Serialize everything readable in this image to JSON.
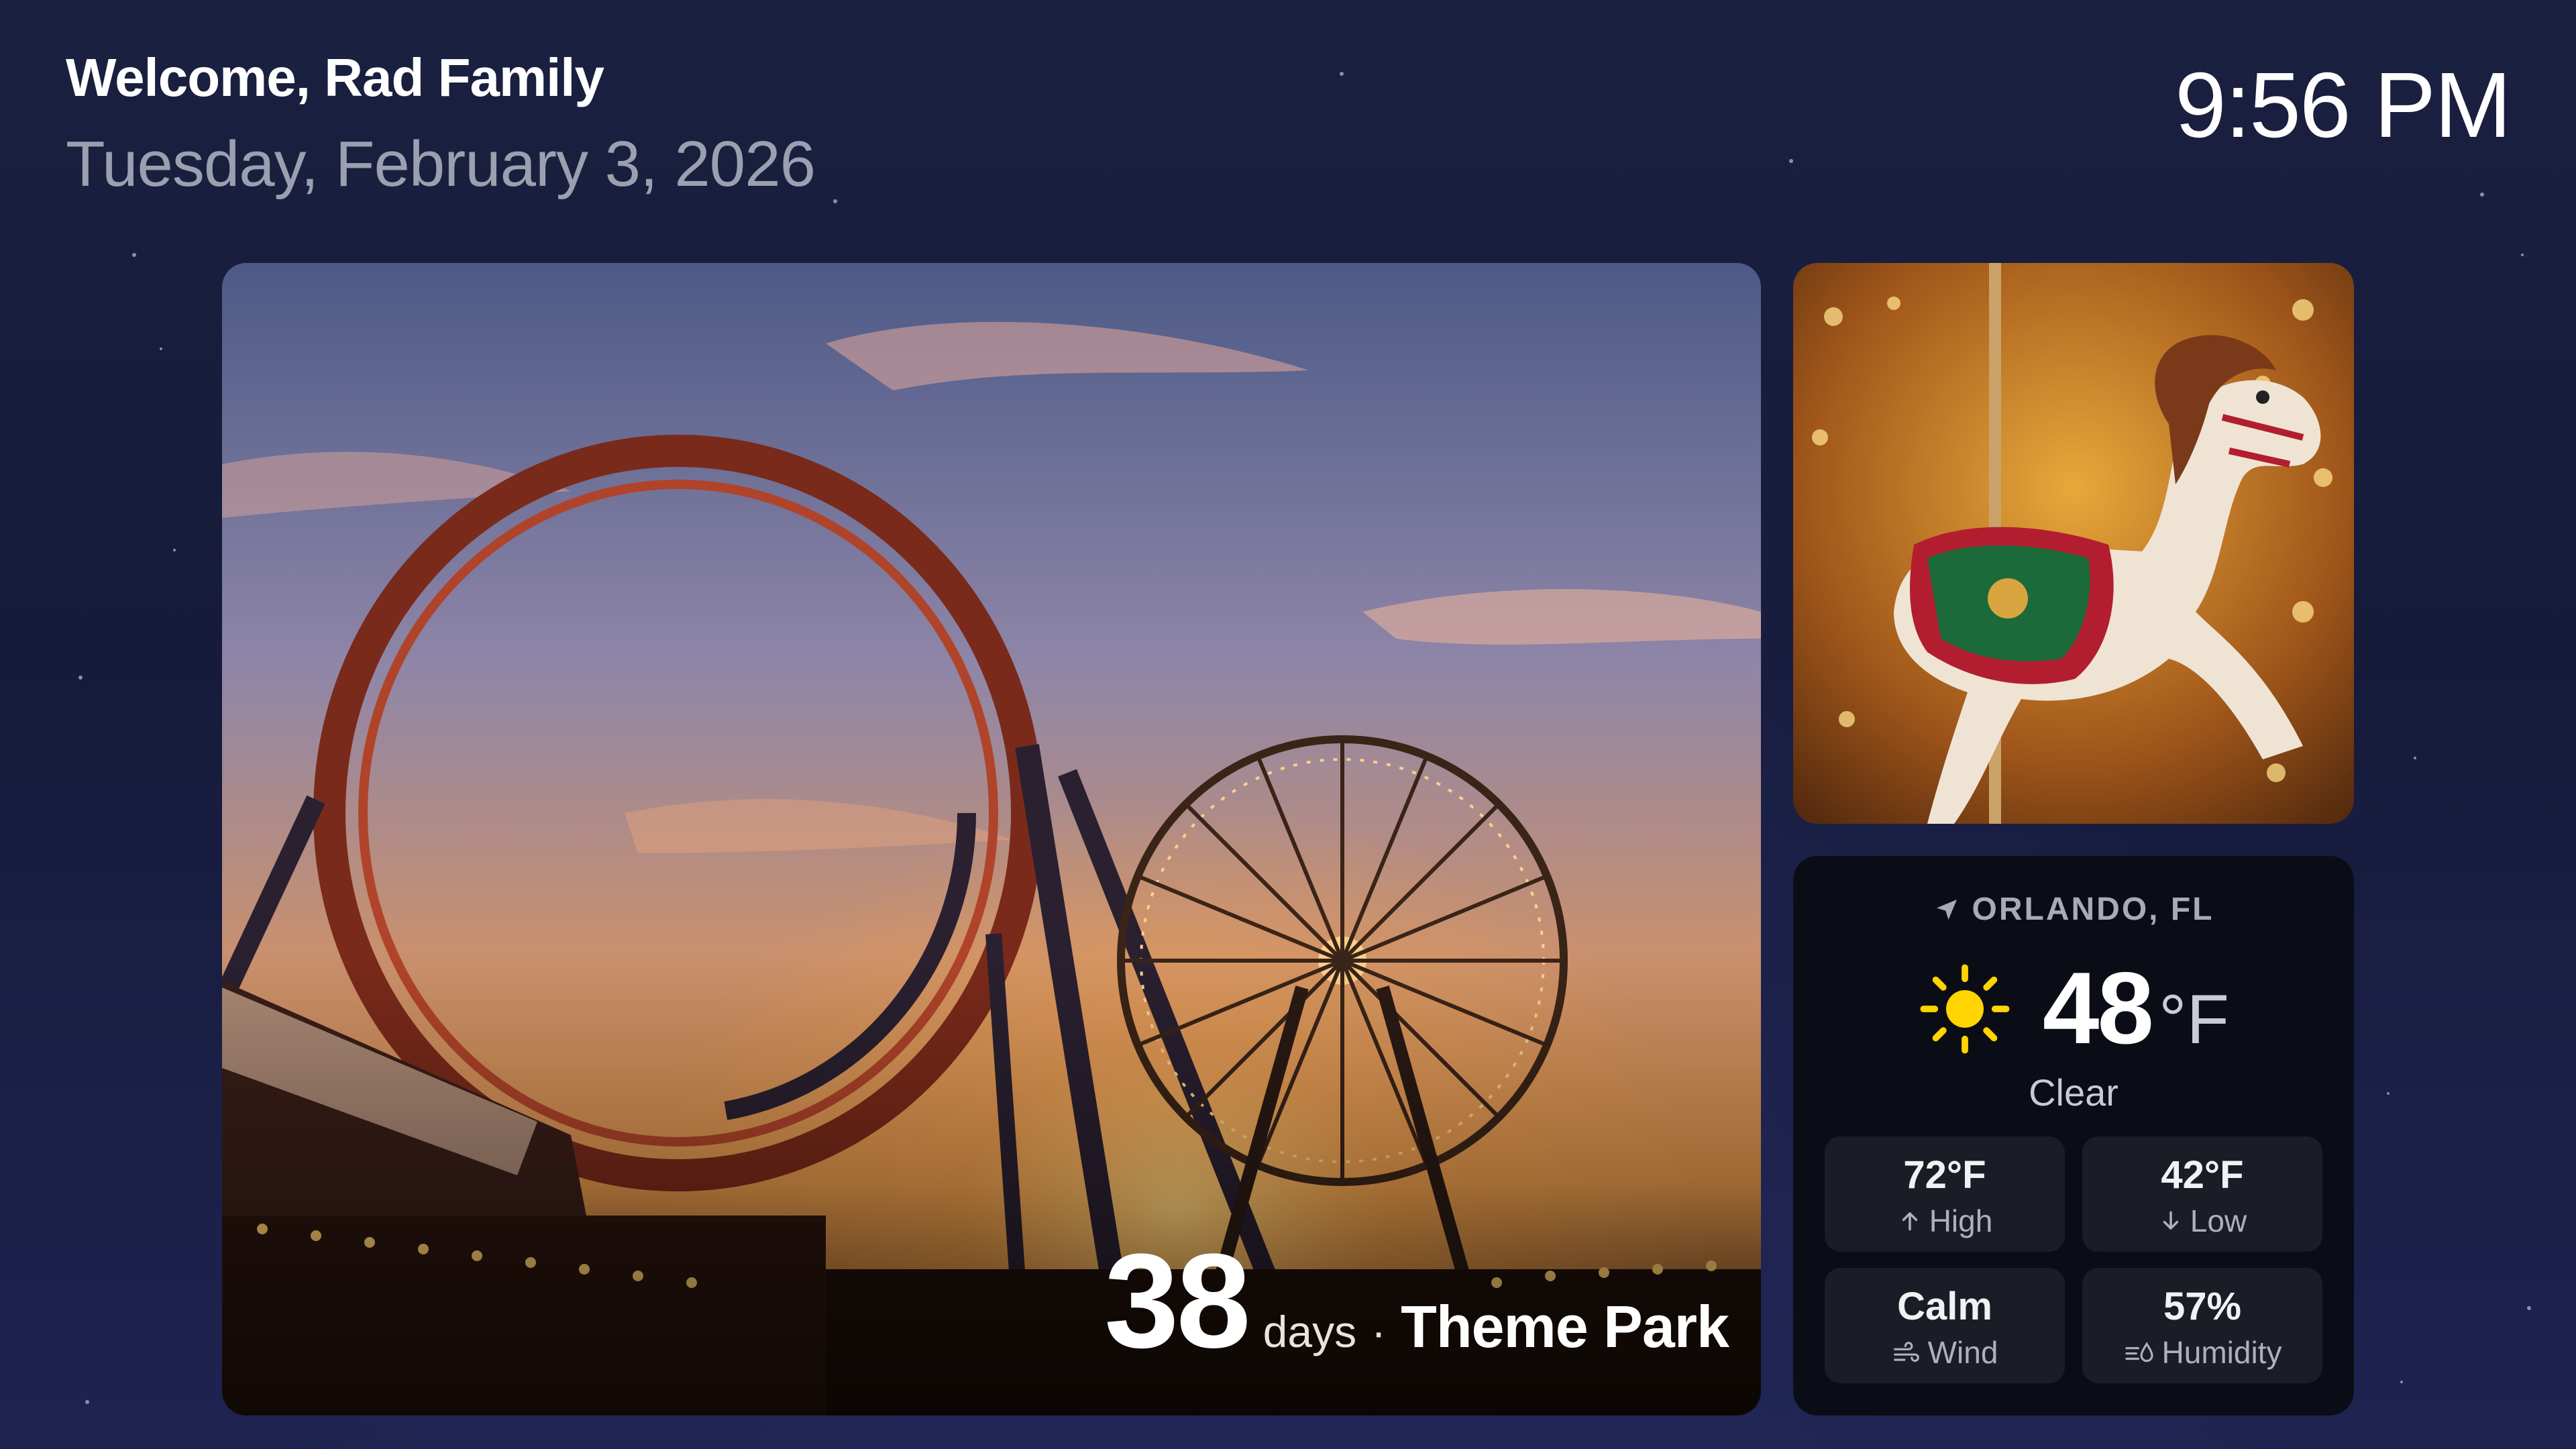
{
  "header": {
    "welcome": "Welcome, Rad Family",
    "date": "Tuesday, February 3, 2026",
    "time": "9:56 PM"
  },
  "countdown": {
    "number": "38",
    "unit": "days",
    "separator": "·",
    "event": "Theme Park"
  },
  "weather": {
    "location": "ORLANDO, FL",
    "location_icon": "location-arrow-icon",
    "condition_icon": "sun-icon",
    "temperature": "48",
    "temperature_unit": "°F",
    "condition": "Clear",
    "high": {
      "value": "72°F",
      "label": "High",
      "icon": "arrow-up-icon"
    },
    "low": {
      "value": "42°F",
      "label": "Low",
      "icon": "arrow-down-icon"
    },
    "wind": {
      "value": "Calm",
      "label": "Wind",
      "icon": "wind-icon"
    },
    "humidity": {
      "value": "57%",
      "label": "Humidity",
      "icon": "humidity-icon"
    }
  },
  "colors": {
    "background": "#1b2040",
    "card": "#0b0d16",
    "tile": "#1b1d26",
    "sun": "#ffd400"
  }
}
